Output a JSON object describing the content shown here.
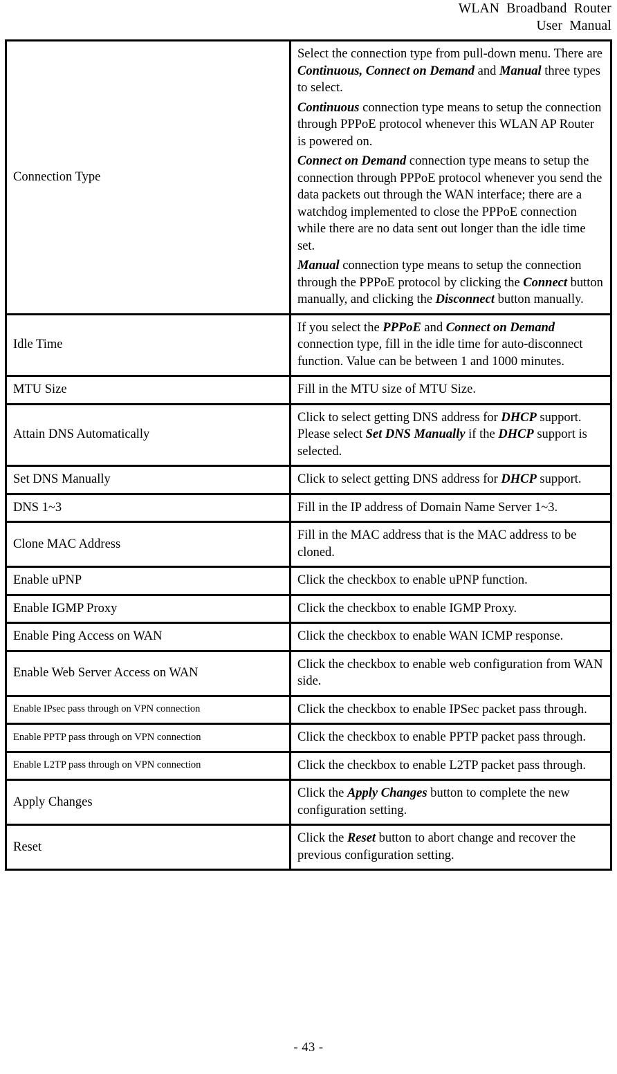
{
  "header": {
    "line1": "WLAN  Broadband  Router",
    "line2": "User  Manual"
  },
  "footer": {
    "page_number": "- 43 -"
  },
  "table": {
    "rows": [
      {
        "term": "Connection Type",
        "term_size": "normal",
        "paragraphs": [
          [
            {
              "t": "Select the connection type from pull-down menu. There are ",
              "b": false
            },
            {
              "t": "Continuous, Connect on Demand",
              "b": true
            },
            {
              "t": " and ",
              "b": false
            },
            {
              "t": "Manual",
              "b": true
            },
            {
              "t": " three types to select.",
              "b": false
            }
          ],
          [
            {
              "t": "Continuous",
              "b": true
            },
            {
              "t": " connection type means to setup the connection through PPPoE protocol whenever this WLAN AP Router is powered on.",
              "b": false
            }
          ],
          [
            {
              "t": "Connect on Demand",
              "b": true
            },
            {
              "t": " connection type means to setup the connection through PPPoE protocol whenever you send the data packets out through the WAN interface; there are a watchdog implemented to close the PPPoE connection while there are no data sent out longer than the idle time set.",
              "b": false
            }
          ],
          [
            {
              "t": "Manual",
              "b": true
            },
            {
              "t": " connection type means to setup the connection through the PPPoE protocol by clicking the ",
              "b": false
            },
            {
              "t": "Connect",
              "b": true
            },
            {
              "t": " button manually, and clicking the ",
              "b": false
            },
            {
              "t": "Disconnect",
              "b": true
            },
            {
              "t": " button manually.",
              "b": false
            }
          ]
        ]
      },
      {
        "term": "Idle Time",
        "term_size": "normal",
        "paragraphs": [
          [
            {
              "t": "If you select the ",
              "b": false
            },
            {
              "t": "PPPoE",
              "b": true
            },
            {
              "t": " and ",
              "b": false
            },
            {
              "t": "Connect on Demand",
              "b": true
            },
            {
              "t": " connection type, fill in the idle time for auto-disconnect function. Value can be between 1 and 1000 minutes.",
              "b": false
            }
          ]
        ]
      },
      {
        "term": "MTU Size",
        "term_size": "normal",
        "paragraphs": [
          [
            {
              "t": "Fill in the MTU size of MTU Size.",
              "b": false
            }
          ]
        ]
      },
      {
        "term": "Attain DNS Automatically",
        "term_size": "normal",
        "paragraphs": [
          [
            {
              "t": "Click to select getting DNS address for ",
              "b": false
            },
            {
              "t": "DHCP",
              "b": true
            },
            {
              "t": " support. Please select ",
              "b": false
            },
            {
              "t": "Set DNS Manually",
              "b": true
            },
            {
              "t": " if the ",
              "b": false
            },
            {
              "t": "DHCP",
              "b": true
            },
            {
              "t": " support is selected.",
              "b": false
            }
          ]
        ]
      },
      {
        "term": "Set DNS Manually",
        "term_size": "normal",
        "paragraphs": [
          [
            {
              "t": "Click to select getting DNS address for ",
              "b": false
            },
            {
              "t": "DHCP",
              "b": true
            },
            {
              "t": " support.",
              "b": false
            }
          ]
        ]
      },
      {
        "term": "DNS 1~3",
        "term_size": "normal",
        "paragraphs": [
          [
            {
              "t": "Fill in the IP address of Domain Name Server 1~3.",
              "b": false
            }
          ]
        ]
      },
      {
        "term": "Clone MAC Address",
        "term_size": "normal",
        "paragraphs": [
          [
            {
              "t": "Fill in the MAC address that is the MAC address to be cloned.",
              "b": false
            }
          ]
        ]
      },
      {
        "term": "Enable uPNP",
        "term_size": "normal",
        "paragraphs": [
          [
            {
              "t": "Click the checkbox to enable uPNP function.",
              "b": false
            }
          ]
        ]
      },
      {
        "term": "Enable IGMP Proxy",
        "term_size": "normal",
        "paragraphs": [
          [
            {
              "t": "Click the checkbox to enable IGMP Proxy.",
              "b": false
            }
          ]
        ]
      },
      {
        "term": "Enable Ping Access on WAN",
        "term_size": "normal",
        "paragraphs": [
          [
            {
              "t": "Click the checkbox to enable WAN ICMP response.",
              "b": false
            }
          ]
        ]
      },
      {
        "term": "Enable Web Server Access on WAN",
        "term_size": "normal",
        "paragraphs": [
          [
            {
              "t": "Click the checkbox to enable web configuration from WAN side.",
              "b": false
            }
          ]
        ]
      },
      {
        "term": "Enable IPsec pass through on VPN connection",
        "term_size": "small",
        "paragraphs": [
          [
            {
              "t": "Click the checkbox to enable IPSec packet pass through.",
              "b": false
            }
          ]
        ]
      },
      {
        "term": "Enable PPTP pass through on VPN connection",
        "term_size": "small",
        "paragraphs": [
          [
            {
              "t": "Click the checkbox to enable PPTP packet pass through.",
              "b": false
            }
          ]
        ]
      },
      {
        "term": "Enable L2TP pass through on VPN connection",
        "term_size": "small",
        "paragraphs": [
          [
            {
              "t": "Click the checkbox to enable L2TP packet pass through.",
              "b": false
            }
          ]
        ]
      },
      {
        "term": "Apply Changes",
        "term_size": "normal",
        "paragraphs": [
          [
            {
              "t": "Click the ",
              "b": false
            },
            {
              "t": "Apply Changes",
              "b": true
            },
            {
              "t": " button to complete the new configuration setting.",
              "b": false
            }
          ]
        ]
      },
      {
        "term": "Reset",
        "term_size": "normal",
        "paragraphs": [
          [
            {
              "t": "Click the ",
              "b": false
            },
            {
              "t": "Reset",
              "b": true
            },
            {
              "t": " button to abort change and recover the previous configuration setting.",
              "b": false
            }
          ]
        ]
      }
    ]
  }
}
